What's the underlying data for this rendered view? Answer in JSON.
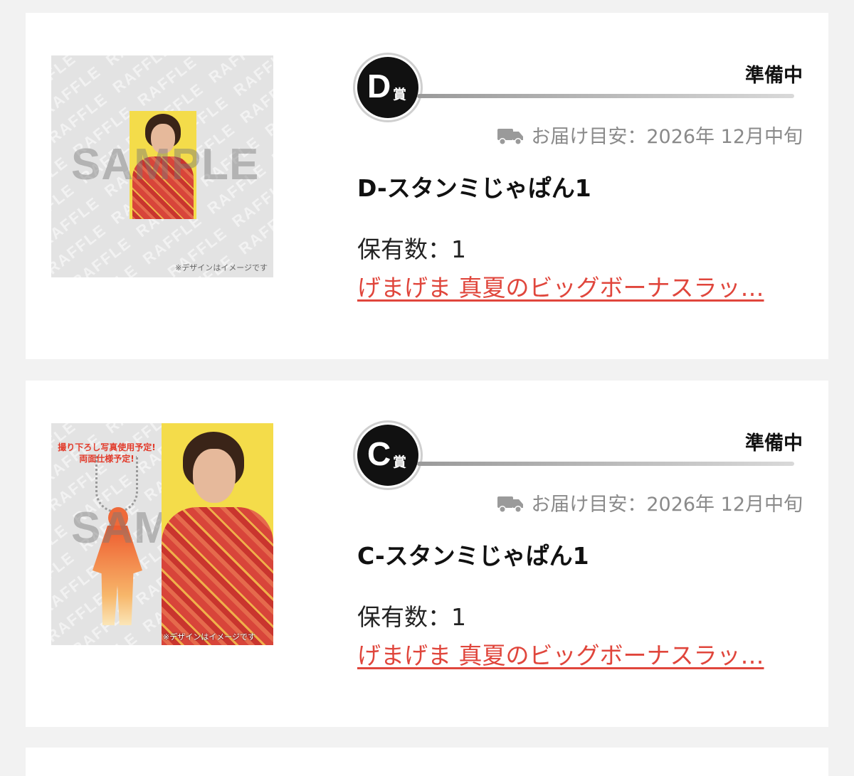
{
  "items": [
    {
      "prize_letter": "D",
      "prize_suffix": "賞",
      "status": "準備中",
      "delivery_text": "お届け目安：2026年 12月中旬",
      "product_name": "D-スタンミじゃぱん1",
      "holding_text": "保有数：1",
      "campaign_link": "げまげま 真夏のビッグボーナスラッ…",
      "image_watermark": "SAMPLE",
      "image_disclaimer": "※デザインはイメージです"
    },
    {
      "prize_letter": "C",
      "prize_suffix": "賞",
      "status": "準備中",
      "delivery_text": "お届け目安：2026年 12月中旬",
      "product_name": "C-スタンミじゃぱん1",
      "holding_text": "保有数：1",
      "campaign_link": "げまげま 真夏のビッグボーナスラッ…",
      "image_watermark": "SAMPLE",
      "image_disclaimer": "※デザインはイメージです",
      "image_banner": "撮り下ろし写真使用予定!\n両面仕様予定!"
    }
  ],
  "icons": {
    "delivery": "truck-icon"
  },
  "colors": {
    "link": "#e0463c",
    "status_text": "#111111",
    "delivery_text": "#8a8a8a"
  }
}
